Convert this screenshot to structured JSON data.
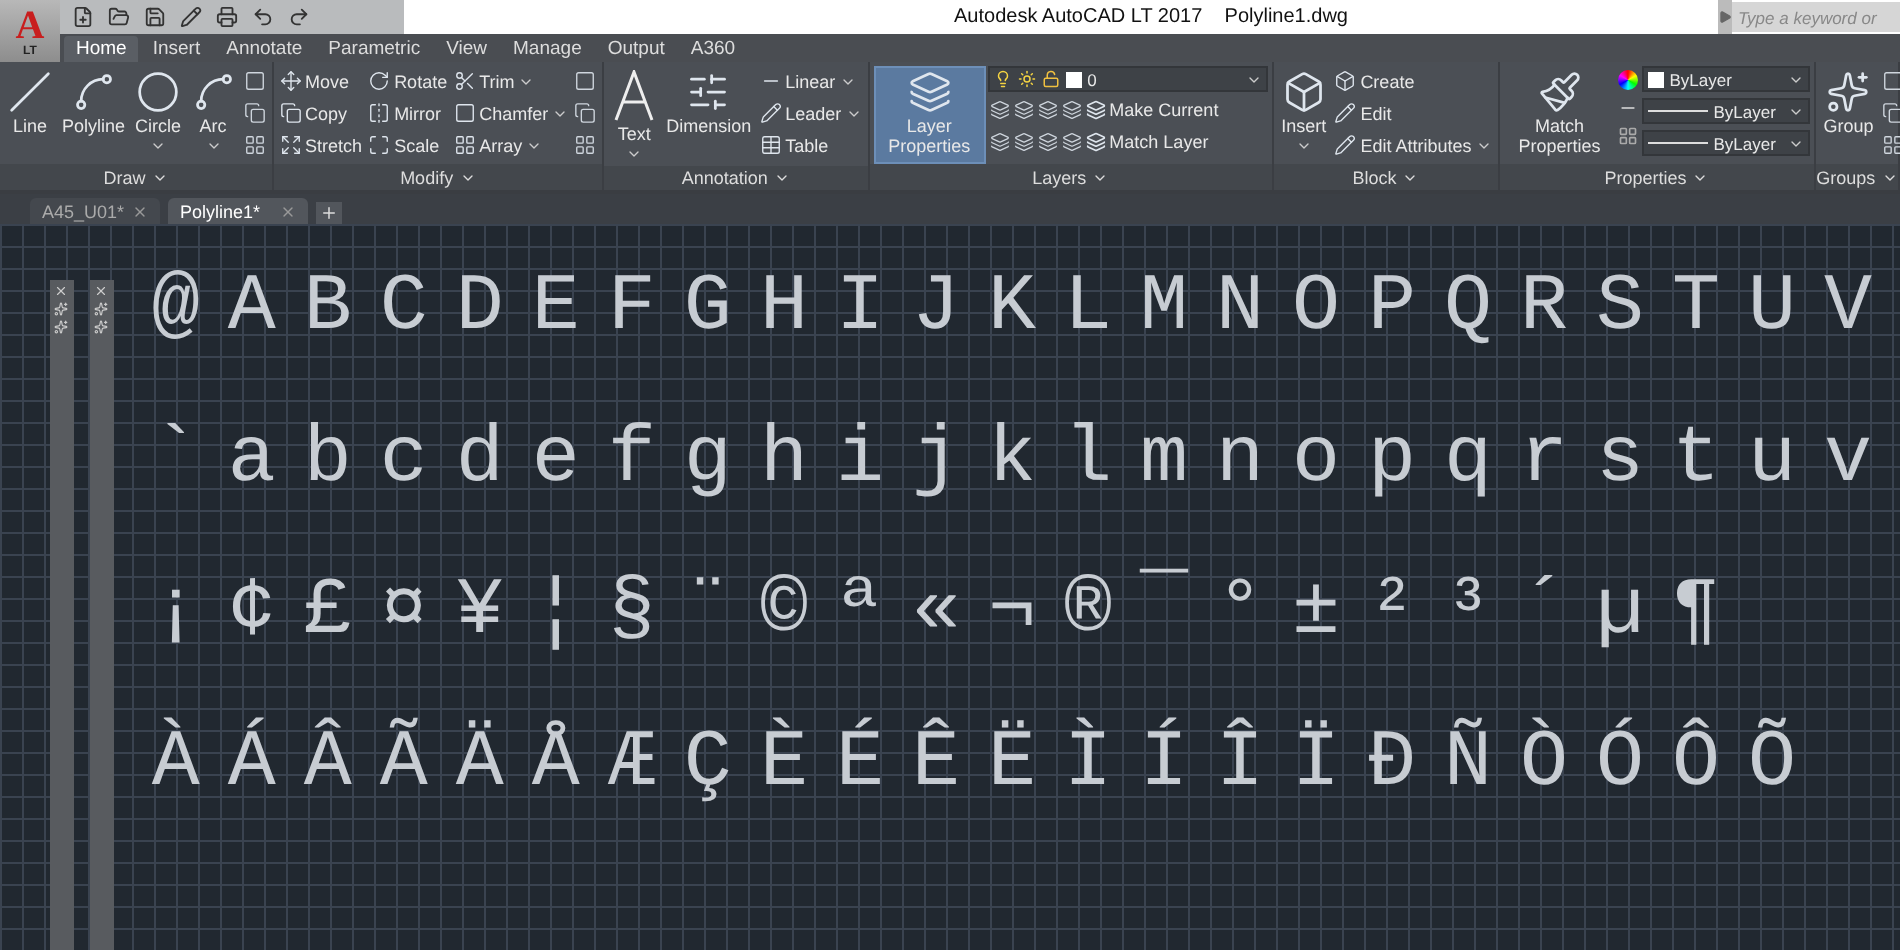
{
  "app_button": {
    "letter": "A",
    "edition": "LT"
  },
  "title": "Autodesk AutoCAD LT 2017    Polyline1.dwg",
  "search": {
    "placeholder": "Type a keyword or"
  },
  "tabs": [
    {
      "label": "Home",
      "selected": true
    },
    {
      "label": "Insert",
      "selected": false
    },
    {
      "label": "Annotate",
      "selected": false
    },
    {
      "label": "Parametric",
      "selected": false
    },
    {
      "label": "View",
      "selected": false
    },
    {
      "label": "Manage",
      "selected": false
    },
    {
      "label": "Output",
      "selected": false
    },
    {
      "label": "A360",
      "selected": false
    }
  ],
  "panels": [
    {
      "title": "Draw",
      "columns": [
        {
          "kind": "large",
          "label": "Line",
          "dropdown": false,
          "selected": false
        },
        {
          "kind": "large",
          "label": "Polyline",
          "dropdown": false,
          "selected": false
        },
        {
          "kind": "large",
          "label": "Circle",
          "dropdown": true,
          "selected": false
        },
        {
          "kind": "large",
          "label": "Arc",
          "dropdown": true,
          "selected": false
        },
        {
          "kind": "icons"
        }
      ]
    },
    {
      "title": "Modify",
      "columns": [
        {
          "kind": "stack",
          "items": [
            {
              "label": "Move",
              "dropdown": false
            },
            {
              "label": "Copy",
              "dropdown": false
            },
            {
              "label": "Stretch",
              "dropdown": false
            }
          ]
        },
        {
          "kind": "stack",
          "items": [
            {
              "label": "Rotate",
              "dropdown": false
            },
            {
              "label": "Mirror",
              "dropdown": false
            },
            {
              "label": "Scale",
              "dropdown": false
            }
          ]
        },
        {
          "kind": "stack",
          "items": [
            {
              "label": "Trim",
              "dropdown": true
            },
            {
              "label": "Chamfer",
              "dropdown": true
            },
            {
              "label": "Array",
              "dropdown": true
            }
          ]
        },
        {
          "kind": "icons"
        }
      ]
    },
    {
      "title": "Annotation",
      "columns": [
        {
          "kind": "large",
          "label": "Text",
          "dropdown": true,
          "selected": false
        },
        {
          "kind": "large",
          "label": "Dimension",
          "dropdown": false,
          "selected": false
        },
        {
          "kind": "stack",
          "items": [
            {
              "label": "Linear",
              "dropdown": true
            },
            {
              "label": "Leader",
              "dropdown": true
            },
            {
              "label": "Table",
              "dropdown": false
            }
          ]
        }
      ]
    },
    {
      "title": "Layers",
      "columns": [
        {
          "kind": "large",
          "label": "Layer Properties",
          "dropdown": false,
          "selected": true
        },
        {
          "kind": "layer_tools",
          "layer": "0",
          "items": [
            {
              "label": "Make Current"
            },
            {
              "label": "Match Layer"
            }
          ]
        }
      ]
    },
    {
      "title": "Block",
      "columns": [
        {
          "kind": "large",
          "label": "Insert",
          "dropdown": true,
          "selected": false
        },
        {
          "kind": "stack",
          "items": [
            {
              "label": "Create",
              "dropdown": false
            },
            {
              "label": "Edit",
              "dropdown": false
            },
            {
              "label": "Edit Attributes",
              "dropdown": true
            }
          ]
        }
      ]
    },
    {
      "title": "Properties",
      "columns": [
        {
          "kind": "large",
          "label": "Match Properties",
          "dropdown": false,
          "selected": false
        },
        {
          "kind": "combos",
          "items": [
            {
              "kind": "color",
              "value": "ByLayer"
            },
            {
              "kind": "line",
              "value": "ByLayer"
            },
            {
              "kind": "line",
              "value": "ByLayer"
            }
          ]
        }
      ]
    },
    {
      "title": "Groups",
      "columns": [
        {
          "kind": "large",
          "label": "Group",
          "dropdown": false,
          "selected": false
        },
        {
          "kind": "icons"
        }
      ]
    }
  ],
  "doc_tabs": [
    {
      "label": "A45_U01*",
      "selected": false
    },
    {
      "label": "Polyline1*",
      "selected": true
    }
  ],
  "canvas": {
    "rows": [
      "@ABCDEFGHIJKLMNOPQRSTUV",
      "`abcdefghijklmnopqrstuv",
      "¡¢£¤¥¦§¨©ª«¬®¯°±²³´µ¶",
      "ÀÁÂÃÄÅÆÇÈÉÊËÌÍÎÏÐÑÒÓÔÕ"
    ]
  }
}
